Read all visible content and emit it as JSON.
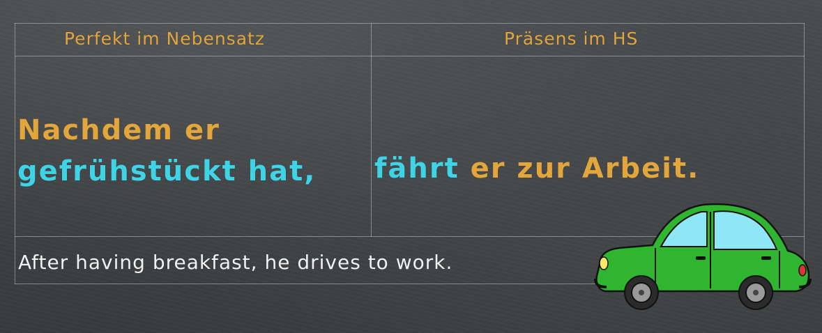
{
  "table": {
    "header_left": "Perfekt im Nebensatz",
    "header_right": "Präsens im HS"
  },
  "sentence": {
    "sub_clause_conjunction": "Nachdem er",
    "sub_clause_verb": "gefrühstückt hat,",
    "main_clause_verb": "fährt",
    "main_clause_rest": " er zur Arbeit."
  },
  "translation": "After having breakfast, he drives to work.",
  "colors": {
    "background": "#424547",
    "orange": "#e3a63c",
    "cyan": "#3fd3e6",
    "white": "#f2f2f2",
    "car_body": "#2fb52f"
  },
  "icons": {
    "car": "green-car-icon"
  }
}
